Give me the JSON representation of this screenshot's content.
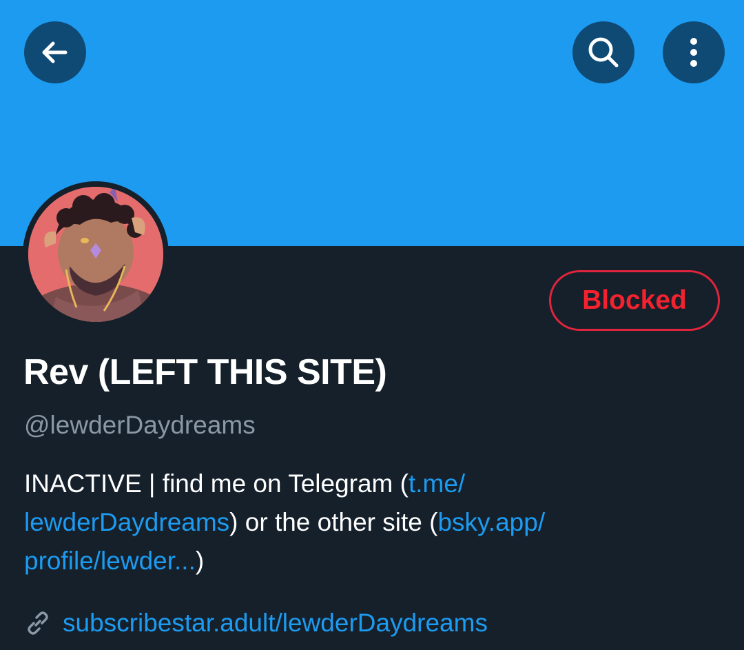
{
  "header": {
    "back_icon": "arrow-left-icon",
    "search_icon": "search-icon",
    "more_icon": "more-vertical-icon",
    "banner_color": "#1d9bf0"
  },
  "profile": {
    "display_name": "Rev (LEFT THIS SITE)",
    "handle": "@lewderDaydreams",
    "blocked_label": "Blocked",
    "bio": {
      "line1_text": "INACTIVE | find me on Telegram (",
      "line1_link": "t.me/",
      "line2_link": "lewderDaydreams",
      "line2_text": ") or the other site (",
      "line2_link2": "bsky.app/",
      "line3_link": "profile/lewder...",
      "line3_text": ")"
    },
    "website": "subscribestar.adult/lewderDaydreams",
    "website_icon": "link-icon"
  },
  "colors": {
    "background": "#15202b",
    "link": "#1d9bf0",
    "blocked": "#f4212e",
    "secondary_text": "#8b98a5"
  }
}
